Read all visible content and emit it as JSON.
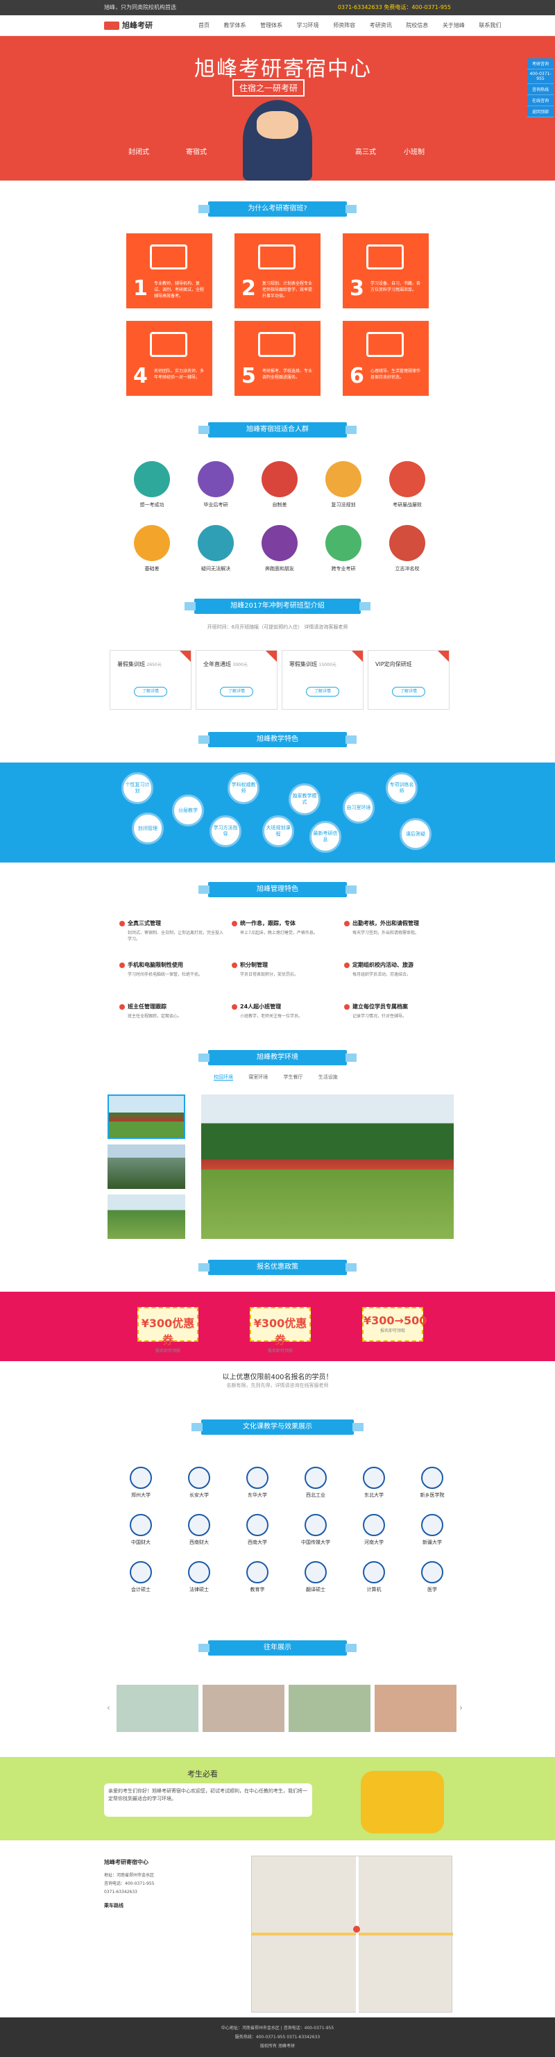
{
  "topbar": {
    "slogan": "旭峰，只为同类院校机构首选",
    "phone": "0371-63342633  免费电话：400-0371-955"
  },
  "nav": {
    "logo": "旭峰考研",
    "items": [
      "首页",
      "教学体系",
      "管理体系",
      "学习环境",
      "师资阵容",
      "考研资讯",
      "院校信息",
      "关于旭峰",
      "联系我们"
    ]
  },
  "hero": {
    "title": "旭峰考研寄宿中心",
    "sub": "住宿之一研考研",
    "points": [
      "封闭式",
      "寄宿式",
      "高三式",
      "小班制"
    ]
  },
  "side": [
    "考研咨询",
    "400-0371-955",
    "咨询热线",
    "在线咨询",
    "返回顶部"
  ],
  "sections": {
    "why": "为什么考研寄宿班?",
    "who": "旭峰寄宿班适合人群",
    "plans": "旭峰2017年冲刺考研班型介绍",
    "plans_note": "开班时间：6月开班随报（可提前预约入住）  详情请咨询客服老师",
    "teach": "旭峰教学特色",
    "manage": "旭峰管理特色",
    "env": "旭峰教学环境",
    "offer": "报名优惠政策",
    "pass": "文化课教学与效果展示",
    "students": "往年展示",
    "guide": "考生必看"
  },
  "why_cards": [
    {
      "n": "1",
      "t": "专业教师、辅导机构、复试、调剂、考研面试，全程辅导高效备考。"
    },
    {
      "n": "2",
      "t": "复习规划、计划表全程专业老师指导跟踪督学，效率提升事半功倍。"
    },
    {
      "n": "3",
      "t": "学习设备、自习、书籍、各方位资料学习氛围浓厚。"
    },
    {
      "n": "4",
      "t": "名师团队、实力派名师、多年考研经验一对一辅导。"
    },
    {
      "n": "5",
      "t": "考研报考、学校选择、专业调剂全程跟进服务。"
    },
    {
      "n": "6",
      "t": "心理疏导、生活管理规律作息保持良好状态。"
    }
  ],
  "who_people": [
    "想一考成功",
    "毕业后考研",
    "自制差",
    "复习没规划",
    "考研屡战屡败",
    "基础差",
    "疑问无法解决",
    "奔跑面和朋友",
    "跨专业考研",
    "立志冲名校"
  ],
  "plans": [
    {
      "name": "暑假集训班",
      "price": "2650元"
    },
    {
      "name": "全年直通班",
      "price": "3000元"
    },
    {
      "name": "寒假集训班",
      "price": "15000元"
    },
    {
      "name": "VIP定向保研班",
      "price": ""
    }
  ],
  "plan_btn": "了解详情",
  "bubbles": [
    "个性复习计划",
    "学科权威教师",
    "专项训练名师",
    "分层教学",
    "独家教学模式",
    "自习室环境",
    "封闭管理",
    "学习方法指导",
    "大班规划课程",
    "最新考研信息",
    "课后答疑"
  ],
  "manage_items": [
    {
      "h": "全真三式管理",
      "d": "封闭式、寄宿制、全日制，让你远离打扰，完全投入学习。"
    },
    {
      "h": "统一作息，跟踪，专体",
      "d": "早上7点起床，晚上熄灯睡觉，严格作息。"
    },
    {
      "h": "出勤考核，外出和请假管理",
      "d": "每天学习签到，外出和请假需审批。"
    },
    {
      "h": "手机和电脑限制性使用",
      "d": "学习时间手机电脑统一保管，杜绝干扰。"
    },
    {
      "h": "积分制管理",
      "d": "学员日常表现积分，奖优罚劣。"
    },
    {
      "h": "定期组织校内活动、旅游",
      "d": "每月组织学员活动，劳逸结合。"
    },
    {
      "h": "班主任管理跟踪",
      "d": "班主任全程跟踪，定期谈心。"
    },
    {
      "h": "24人超小班管理",
      "d": "小班教学，老师关注每一位学员。"
    },
    {
      "h": "建立每位学员专属档案",
      "d": "记录学习情况，针对性辅导。"
    }
  ],
  "env_tabs": [
    "校园环境",
    "寝室环境",
    "学生餐厅",
    "生活设施"
  ],
  "coupons": [
    "¥300优惠券",
    "¥300优惠券",
    "¥300→500"
  ],
  "coupon_sub": "报名即可领取",
  "offer_line": "以上优惠仅限前400名报名的学员！",
  "offer_note": "名额有限，先到先得，详情请咨询在线客服老师",
  "universities": [
    "郑州大学",
    "长安大学",
    "东华大学",
    "西北工业",
    "东北大学",
    "新乡医学院",
    "中国财大",
    "西南财大",
    "西南大学",
    "中国传媒大学",
    "河南大学",
    "新疆大学",
    "会计硕士",
    "法律硕士",
    "教育学",
    "翻译硕士",
    "计算机",
    "医学"
  ],
  "guide_text": "亲爱的考生们你好！旭峰考研寄宿中心欢迎您，初试考试顺利，在中心任教的考生，我们将一定帮你找到最适合的学习环境。",
  "address": {
    "title": "旭峰考研寄宿中心",
    "lines": [
      "地址：河南省郑州市金水区",
      "咨询电话：400-0371-955",
      "0371-63342633",
      "乘车路线"
    ]
  },
  "footer": [
    "中心地址：河南省郑州市金水区 | 咨询电话：400-0371-955",
    "服务热线：400-0371-955  0371-63342633",
    "版权所有 旭峰考研"
  ]
}
